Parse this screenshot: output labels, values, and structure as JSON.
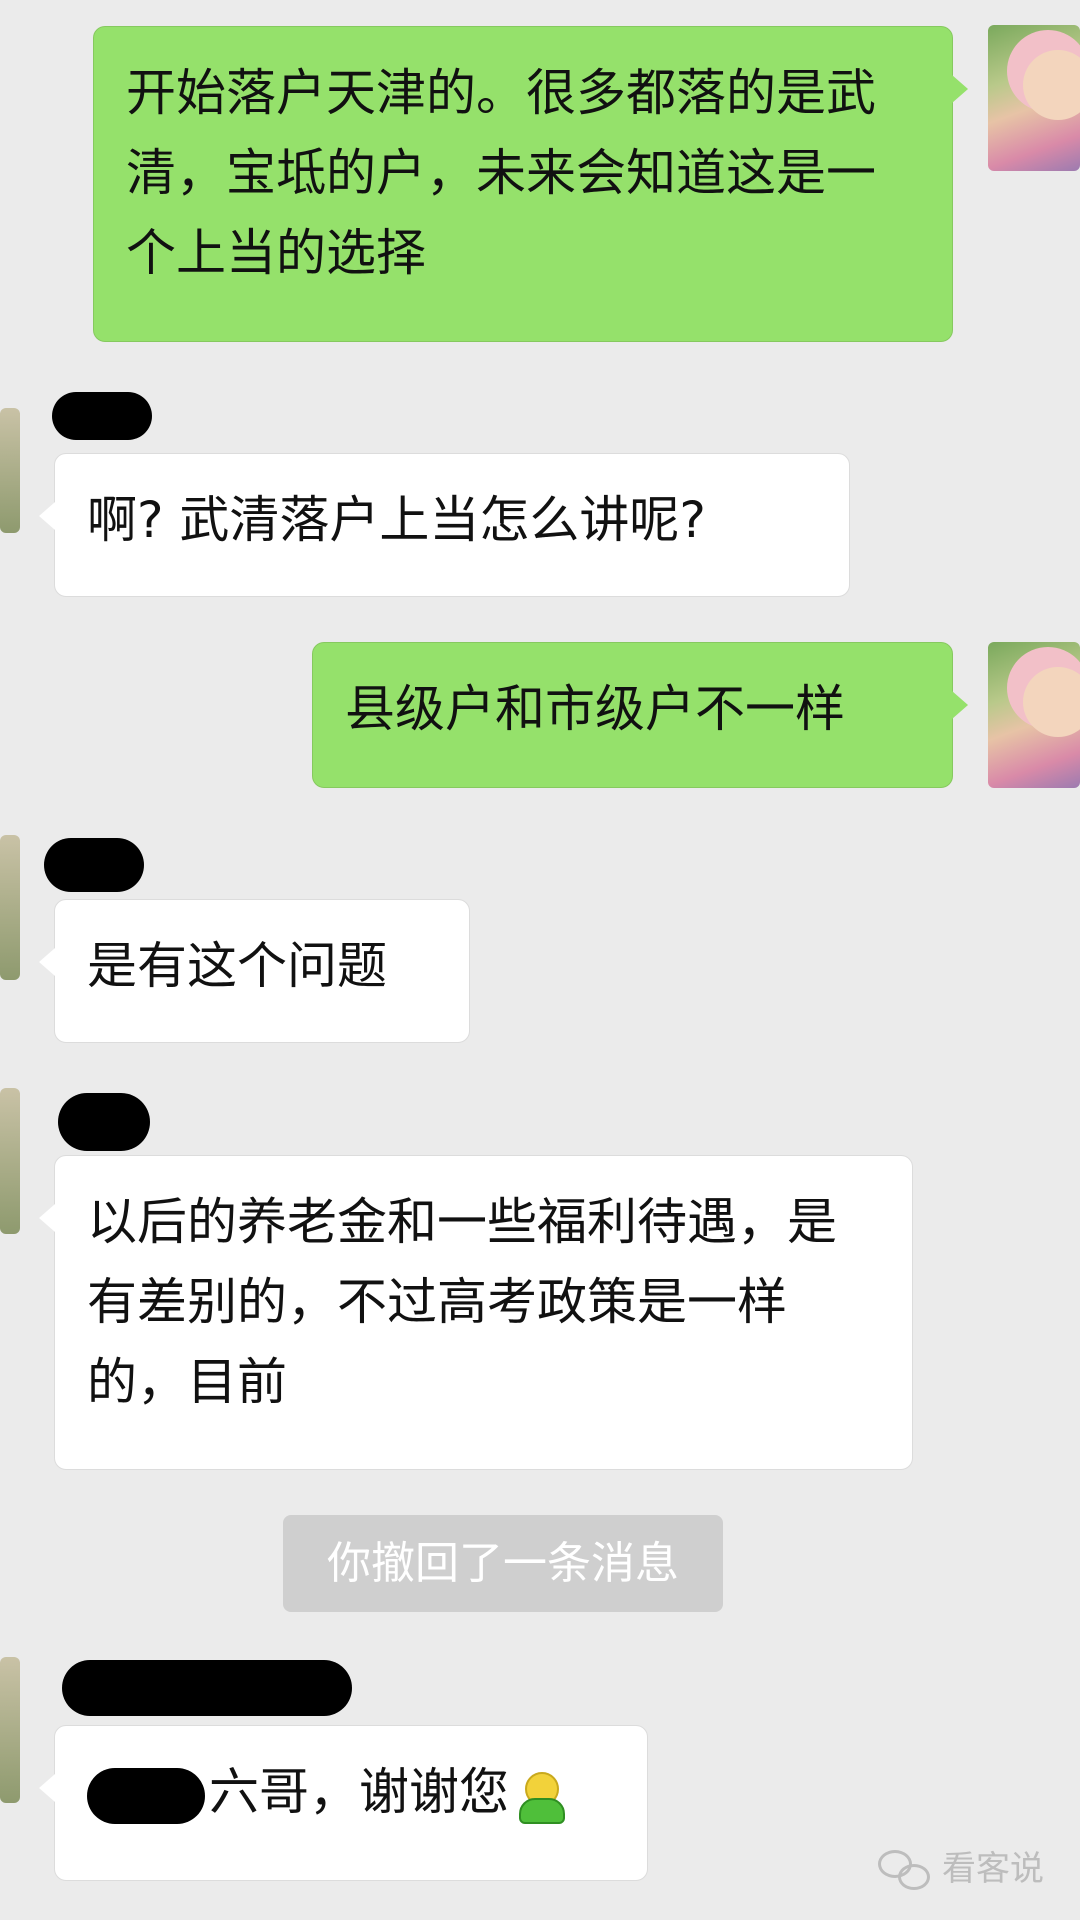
{
  "messages": [
    {
      "side": "me",
      "text": "开始落户天津的。很多都落的是武清，宝坻的户，未来会知道这是一个上当的选择"
    },
    {
      "side": "other",
      "text": "啊? 武清落户上当怎么讲呢?"
    },
    {
      "side": "me",
      "text": "县级户和市级户不一样"
    },
    {
      "side": "other",
      "text": "是有这个问题"
    },
    {
      "side": "other",
      "text": "以后的养老金和一些福利待遇，是有差别的，不过高考政策是一样的，目前"
    },
    {
      "side": "other",
      "text": "六哥，谢谢您"
    }
  ],
  "system_notice": "你撤回了一条消息",
  "watermark": "看客说",
  "icons": {
    "emoji": "smiley-person-emoji",
    "watermark": "wechat-logo-icon"
  },
  "colors": {
    "background": "#ebebeb",
    "my_bubble": "#95e16b",
    "other_bubble": "#ffffff",
    "system_bg": "#cfcfcf"
  }
}
